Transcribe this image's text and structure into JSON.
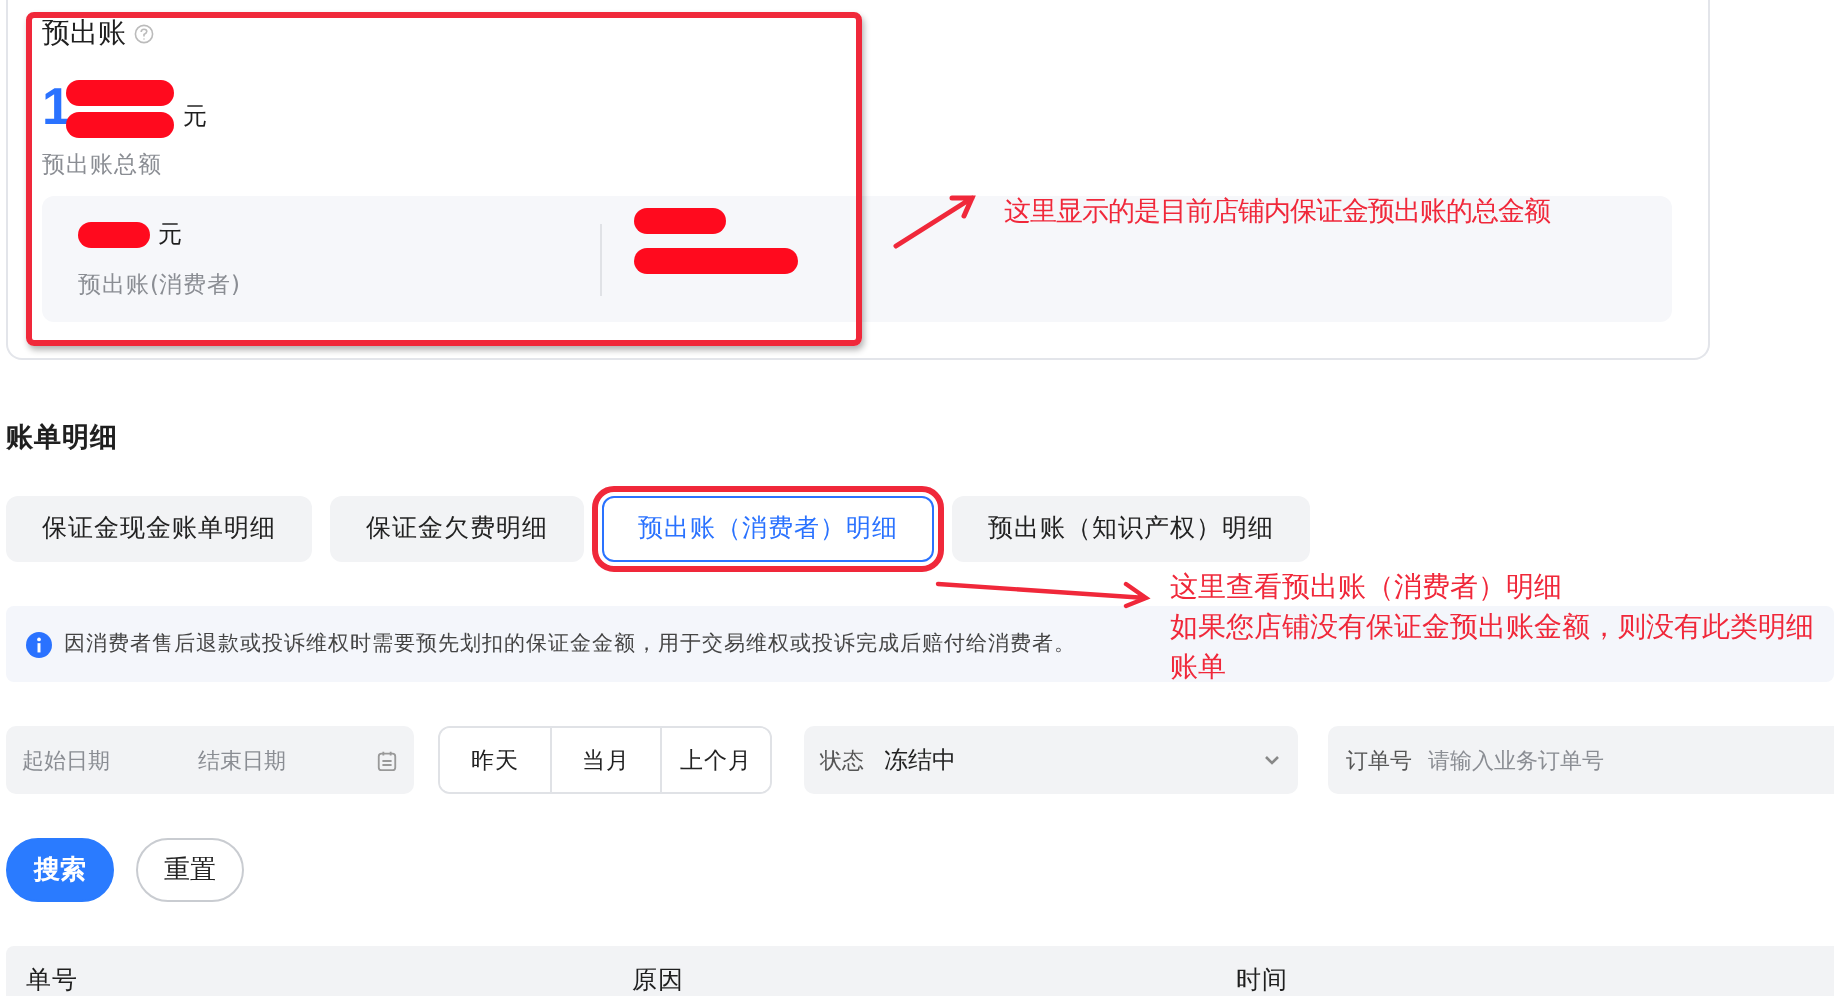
{
  "overview": {
    "title": "预出账",
    "highlighted": true,
    "note": "这里显示的是目前店铺内保证金预出账的总金额",
    "total": {
      "amount": "1",
      "unit": "元",
      "label": "预出账总额",
      "redacted": true
    },
    "items": [
      {
        "unit": "元",
        "label": "预出账(消费者)",
        "redacted": true
      },
      {
        "kind": "redacted"
      }
    ]
  },
  "section_title": "账单明细",
  "tabs": [
    {
      "label": "保证金现金账单明细",
      "selected": false,
      "highlighted": false
    },
    {
      "label": "保证金欠费明细",
      "selected": false,
      "highlighted": false
    },
    {
      "label": "预出账（消费者）明细",
      "selected": true,
      "highlighted": true
    },
    {
      "label": "预出账（知识产权）明细",
      "selected": false,
      "highlighted": false
    }
  ],
  "tab_note": [
    "这里查看预出账（消费者）明细",
    "如果您店铺没有保证金预出账金额，则没有此类明细账单"
  ],
  "info": "因消费者售后退款或投诉维权时需要预先划扣的保证金金额，用于交易维权或投诉完成后赔付给消费者。",
  "filters": {
    "start_placeholder": "起始日期",
    "end_placeholder": "结束日期",
    "ranges": [
      {
        "label": "昨天",
        "selected": false
      },
      {
        "label": "当月",
        "selected": false
      },
      {
        "label": "上个月",
        "selected": false
      }
    ],
    "status": {
      "label": "状态",
      "value": "冻结中"
    },
    "order": {
      "label": "订单号",
      "placeholder": "请输入业务订单号"
    }
  },
  "buttons": [
    {
      "label": "搜索",
      "kind": "primary"
    },
    {
      "label": "重置",
      "kind": "default"
    }
  ],
  "table": {
    "columns": [
      "单号",
      "原因",
      "时间"
    ]
  }
}
